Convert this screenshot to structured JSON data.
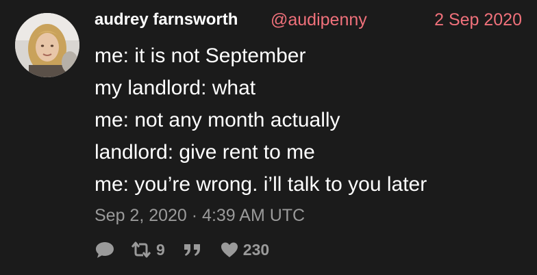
{
  "author": {
    "display_name": "audrey farnsworth",
    "handle": "@audipenny"
  },
  "tweet": {
    "date_short": "2 Sep 2020",
    "lines": [
      "me: it is not September",
      "my landlord: what",
      "me: not any month actually",
      "landlord: give rent to me",
      "me: you’re wrong. i’ll talk to you later"
    ],
    "timestamp": "Sep 2, 2020 · 4:39 AM UTC"
  },
  "stats": {
    "retweets": "9",
    "likes": "230"
  },
  "icons": {
    "reply": "comment-icon",
    "retweet": "retweet-icon",
    "quote": "quote-icon",
    "like": "heart-icon"
  },
  "colors": {
    "background": "#1b1b1b",
    "accent": "#f0717b",
    "muted": "#9a9a9a",
    "text": "#ffffff"
  }
}
